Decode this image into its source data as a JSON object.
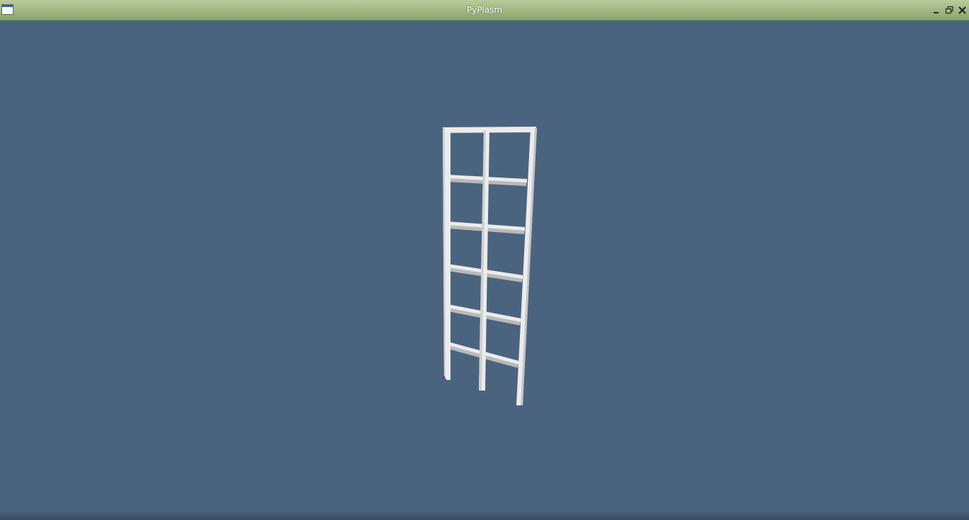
{
  "window": {
    "title": "PyPlasm",
    "controls": {
      "minimize_icon": "minimize-icon",
      "maximize_icon": "restore-icon",
      "close_icon": "close-icon"
    }
  },
  "viewport": {
    "background_color": "#4a6480",
    "model_color": "#ececec",
    "model_shade_color": "#b9b9b9"
  }
}
